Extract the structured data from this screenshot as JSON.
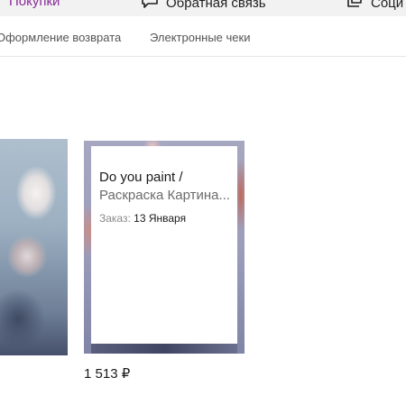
{
  "top_nav": {
    "purchases_label": "Покупки",
    "feedback_label": "Обратная связь",
    "social_label": "Соци",
    "accent_color": "#8a2c9a"
  },
  "tabs": [
    {
      "label": "Оформление возврата"
    },
    {
      "label": "Электронные чеки"
    }
  ],
  "product": {
    "brand": "Do you paint",
    "separator": " /",
    "name": "Раскраска Картина...",
    "order_label": "Заказ:",
    "order_date": "13 Января",
    "price": "1 513 ₽"
  },
  "icons": {
    "feedback": "chat-bubble-icon",
    "social": "social-icon"
  }
}
